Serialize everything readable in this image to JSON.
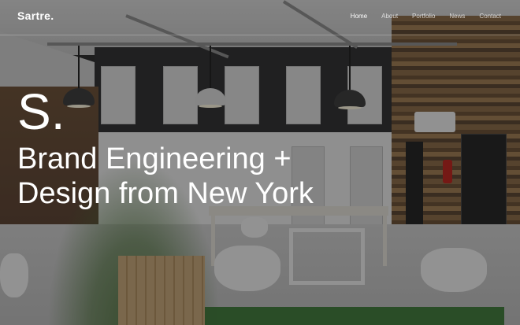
{
  "brand": {
    "logo_text": "Sartre."
  },
  "nav": {
    "items": [
      {
        "label": "Home",
        "active": true
      },
      {
        "label": "About",
        "active": false
      },
      {
        "label": "Portfolio",
        "active": false
      },
      {
        "label": "News",
        "active": false
      },
      {
        "label": "Contact",
        "active": false
      }
    ]
  },
  "hero": {
    "mark": "S.",
    "title": "Brand Engineering + Design from New York"
  },
  "colors": {
    "text": "#ffffff",
    "nav_inactive": "rgba(255,255,255,0.72)",
    "overlay": "rgba(15,15,15,0.42)"
  }
}
